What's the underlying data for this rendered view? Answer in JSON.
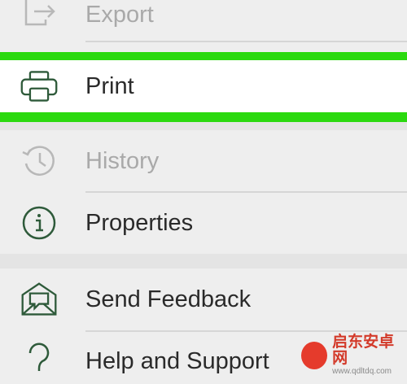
{
  "menu": {
    "items": [
      {
        "label": "Export",
        "icon": "export-icon",
        "state": "disabled"
      },
      {
        "label": "Print",
        "icon": "printer-icon",
        "state": "highlighted"
      },
      {
        "label": "History",
        "icon": "history-icon",
        "state": "disabled"
      },
      {
        "label": "Properties",
        "icon": "info-icon",
        "state": "enabled"
      },
      {
        "label": "Send Feedback",
        "icon": "feedback-envelope-icon",
        "state": "enabled"
      },
      {
        "label": "Help and Support",
        "icon": "question-icon",
        "state": "enabled"
      }
    ],
    "highlight_color": "#2bd90f",
    "icon_color": "#2e5a3a",
    "disabled_color": "#a9a9a9"
  },
  "watermark": {
    "title": "启东安卓网",
    "url": "www.qdltdq.com"
  }
}
